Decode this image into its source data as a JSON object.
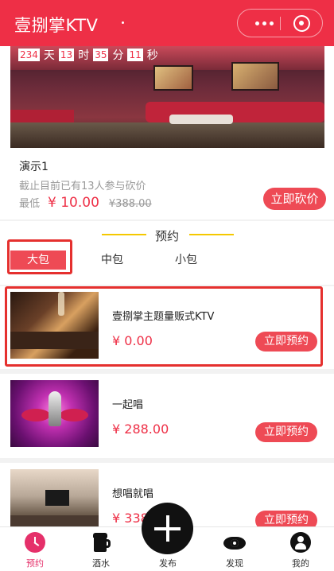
{
  "header": {
    "title": "壹捌掌KTV",
    "more_icon": "more-dots-icon",
    "close_icon": "target-close-icon"
  },
  "bargain": {
    "countdown": {
      "days": "234",
      "days_unit": "天",
      "hours": "13",
      "hours_unit": "时",
      "minutes": "35",
      "minutes_unit": "分",
      "seconds": "11",
      "seconds_unit": "秒"
    },
    "name": "演示1",
    "note": "截止目前已有13人参与砍价",
    "lowest_label": "最低",
    "price": "¥ 10.00",
    "original_price": "¥388.00",
    "button": "立即砍价"
  },
  "reserve": {
    "title": "预约",
    "tabs": [
      "大包",
      "中包",
      "小包"
    ],
    "active_tab": 0
  },
  "items": [
    {
      "name": "壹捌掌主题量贩式KTV",
      "price": "¥ 0.00",
      "button": "立即预约"
    },
    {
      "name": "一起唱",
      "price": "¥ 288.00",
      "button": "立即预约"
    },
    {
      "name": "想唱就唱",
      "price": "¥ 338",
      "button": "立即预约"
    }
  ],
  "tabbar": {
    "items": [
      {
        "label": "预约",
        "icon": "clock-icon",
        "active": true
      },
      {
        "label": "酒水",
        "icon": "beer-icon",
        "active": false
      },
      {
        "label": "发布",
        "icon": "plus-icon",
        "active": false
      },
      {
        "label": "发现",
        "icon": "eye-icon",
        "active": false
      },
      {
        "label": "我的",
        "icon": "user-icon",
        "active": false
      }
    ]
  },
  "colors": {
    "brand_red": "#ee2f46",
    "button_red": "#ee4a55",
    "active_tab_pink": "#e5306a",
    "divider_yellow": "#f5c800"
  }
}
